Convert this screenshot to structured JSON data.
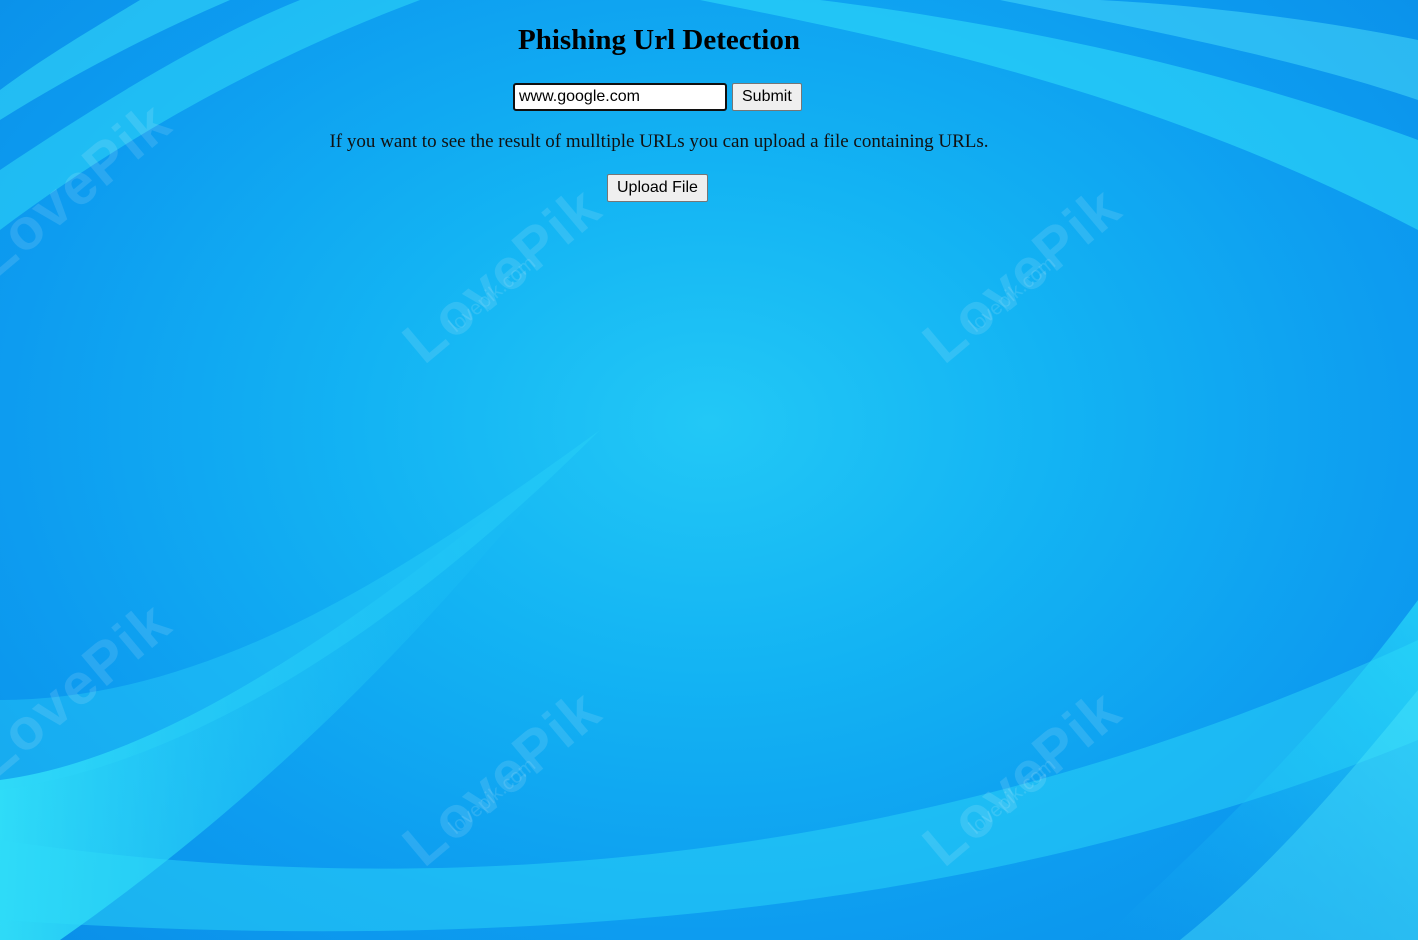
{
  "page": {
    "title": "Phishing Url Detection",
    "url_input": {
      "value": "www.google.com",
      "placeholder": ""
    },
    "submit_label": "Submit",
    "info_text": "If you want to see the result of mulltiple URLs you can upload a file containing URLs.",
    "upload_label": "Upload File"
  },
  "background": {
    "watermark_brand": "LovePik",
    "watermark_domain": "lovepik.com",
    "colors": {
      "base": "#0d9cf0",
      "highlight": "#2ee6fb"
    }
  }
}
